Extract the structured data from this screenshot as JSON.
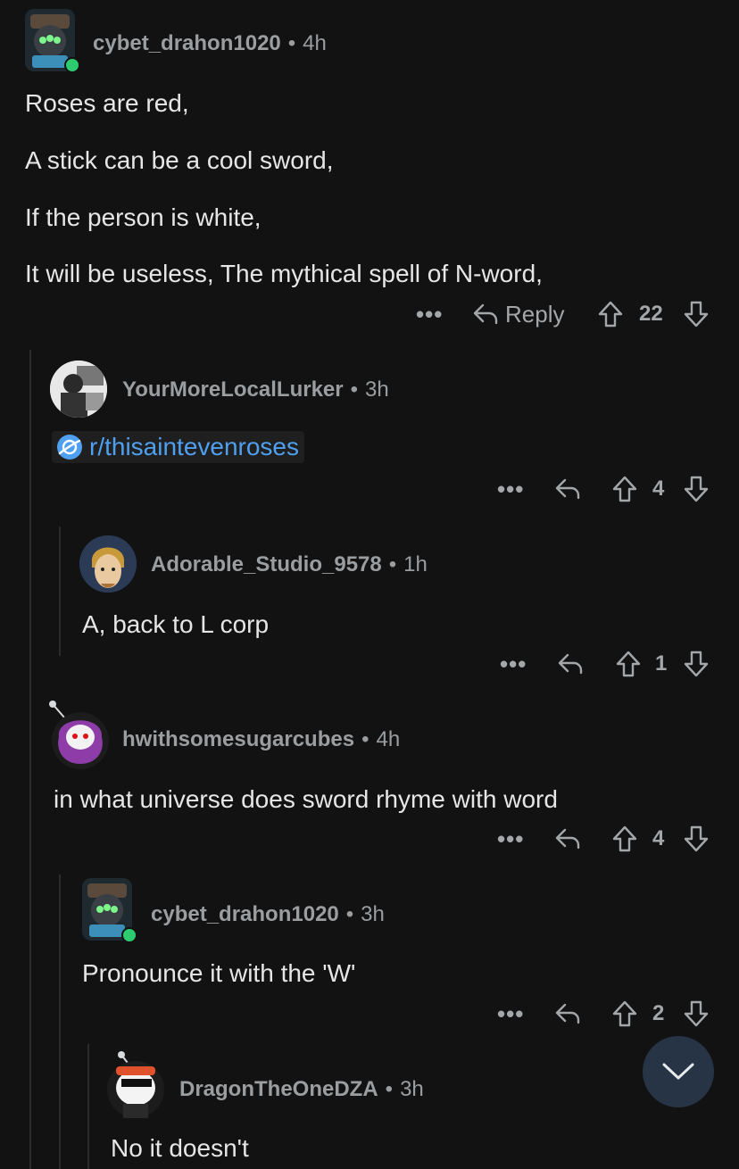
{
  "comments": [
    {
      "user": "cybet_drahon1020",
      "age": "4h",
      "lines": [
        "Roses are red,",
        "A stick can be a cool sword,",
        "If the person is white,",
        "It will be useless, The mythical spell of N-word,"
      ],
      "reply_label": "Reply",
      "score": "22"
    },
    {
      "user": "YourMoreLocalLurker",
      "age": "3h",
      "link": "r/thisaintevenroses",
      "score": "4"
    },
    {
      "user": "Adorable_Studio_9578",
      "age": "1h",
      "text": "A, back to L corp",
      "score": "1"
    },
    {
      "user": "hwithsomesugarcubes",
      "age": "4h",
      "text": "in what universe does sword rhyme with word",
      "score": "4"
    },
    {
      "user": "cybet_drahon1020",
      "age": "3h",
      "text": "Pronounce it with the 'W'",
      "score": "2"
    },
    {
      "user": "DragonTheOneDZA",
      "age": "3h",
      "text": "No it doesn't"
    }
  ],
  "separator": "•",
  "more_label": "•••",
  "icons": {
    "more": "more-icon",
    "reply": "reply-arrow-icon",
    "upvote": "upvote-arrow-icon",
    "downvote": "downvote-arrow-icon",
    "scroll": "chevron-down-icon"
  },
  "colors": {
    "background": "#121212",
    "link": "#4fa0f0",
    "online": "#2ecc71",
    "fab": "#263446"
  }
}
